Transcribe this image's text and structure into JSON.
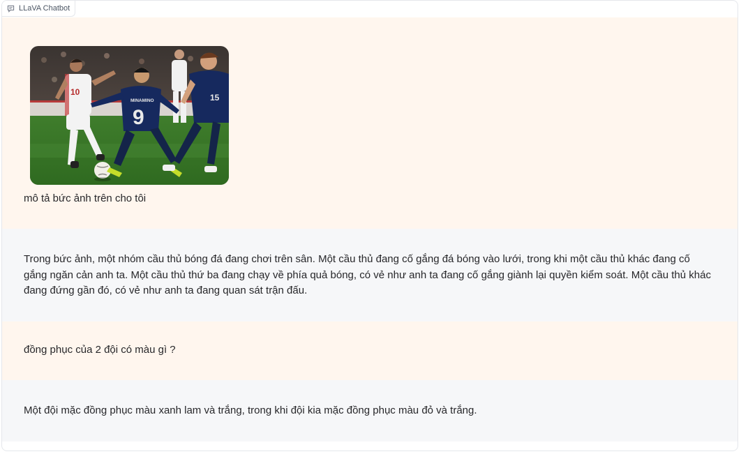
{
  "header": {
    "label": "LLaVA Chatbot",
    "icon": "chat-bubble-icon"
  },
  "messages": [
    {
      "role": "user",
      "image": {
        "kind": "photo",
        "jersey_numbers": [
          "10",
          "9",
          "15"
        ],
        "jersey_name": "MINAMINO"
      },
      "text": "mô tả bức ảnh trên cho tôi"
    },
    {
      "role": "assistant",
      "text": "Trong bức ảnh, một nhóm cầu thủ bóng đá đang chơi trên sân. Một cầu thủ đang cố gắng đá bóng vào lưới, trong khi một cầu thủ khác đang cố gắng ngăn cản anh ta. Một cầu thủ thứ ba đang chạy về phía quả bóng, có vẻ như anh ta đang cố gắng giành lại quyền kiểm soát. Một cầu thủ khác đang đứng gần đó, có vẻ như anh ta đang quan sát trận đấu."
    },
    {
      "role": "user",
      "text": "đồng phục của 2 đội có màu gì ?"
    },
    {
      "role": "assistant",
      "text": "Một đội mặc đồng phục màu xanh lam và trắng, trong khi đội kia mặc đồng phục màu đỏ và trắng."
    }
  ],
  "colors": {
    "user_bg": "#fff6ee",
    "bot_bg": "#f6f7f9",
    "border": "#e5e7eb"
  }
}
